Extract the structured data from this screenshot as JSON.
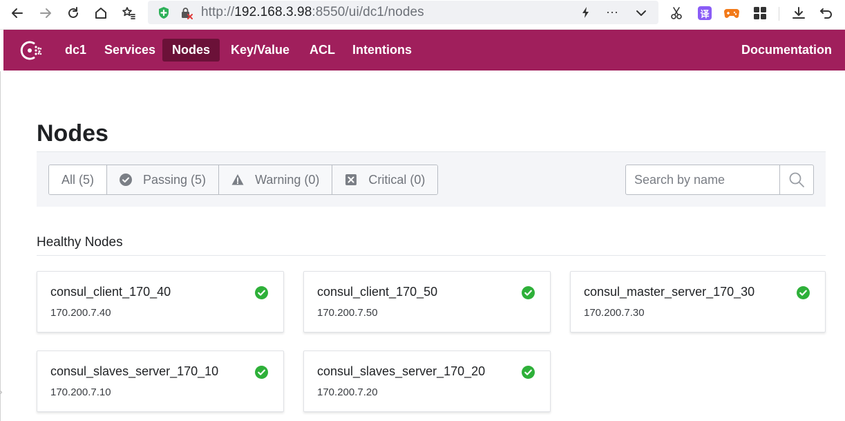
{
  "browser": {
    "url_scheme": "http://",
    "url_host": "192.168.3.98",
    "url_rest": ":8550/ui/dc1/nodes",
    "translate_label": "译"
  },
  "header": {
    "datacenter": "dc1",
    "nav": [
      "Services",
      "Nodes",
      "Key/Value",
      "ACL",
      "Intentions"
    ],
    "active_nav": "Nodes",
    "documentation": "Documentation",
    "brand_color": "#a01f5c",
    "active_color": "#6b1138"
  },
  "page": {
    "title": "Nodes",
    "filters": [
      {
        "label": "All (5)",
        "icon": ""
      },
      {
        "label": "Passing (5)",
        "icon": "check-circle-icon"
      },
      {
        "label": "Warning (0)",
        "icon": "warning-triangle-icon"
      },
      {
        "label": "Critical (0)",
        "icon": "x-square-icon"
      }
    ],
    "search_placeholder": "Search by name",
    "section_title": "Healthy Nodes",
    "nodes": [
      {
        "name": "consul_client_170_40",
        "address": "170.200.7.40",
        "status": "passing"
      },
      {
        "name": "consul_client_170_50",
        "address": "170.200.7.50",
        "status": "passing"
      },
      {
        "name": "consul_master_server_170_30",
        "address": "170.200.7.30",
        "status": "passing"
      },
      {
        "name": "consul_slaves_server_170_10",
        "address": "170.200.7.10",
        "status": "passing"
      },
      {
        "name": "consul_slaves_server_170_20",
        "address": "170.200.7.20",
        "status": "passing"
      }
    ],
    "passing_color": "#2eb039"
  }
}
